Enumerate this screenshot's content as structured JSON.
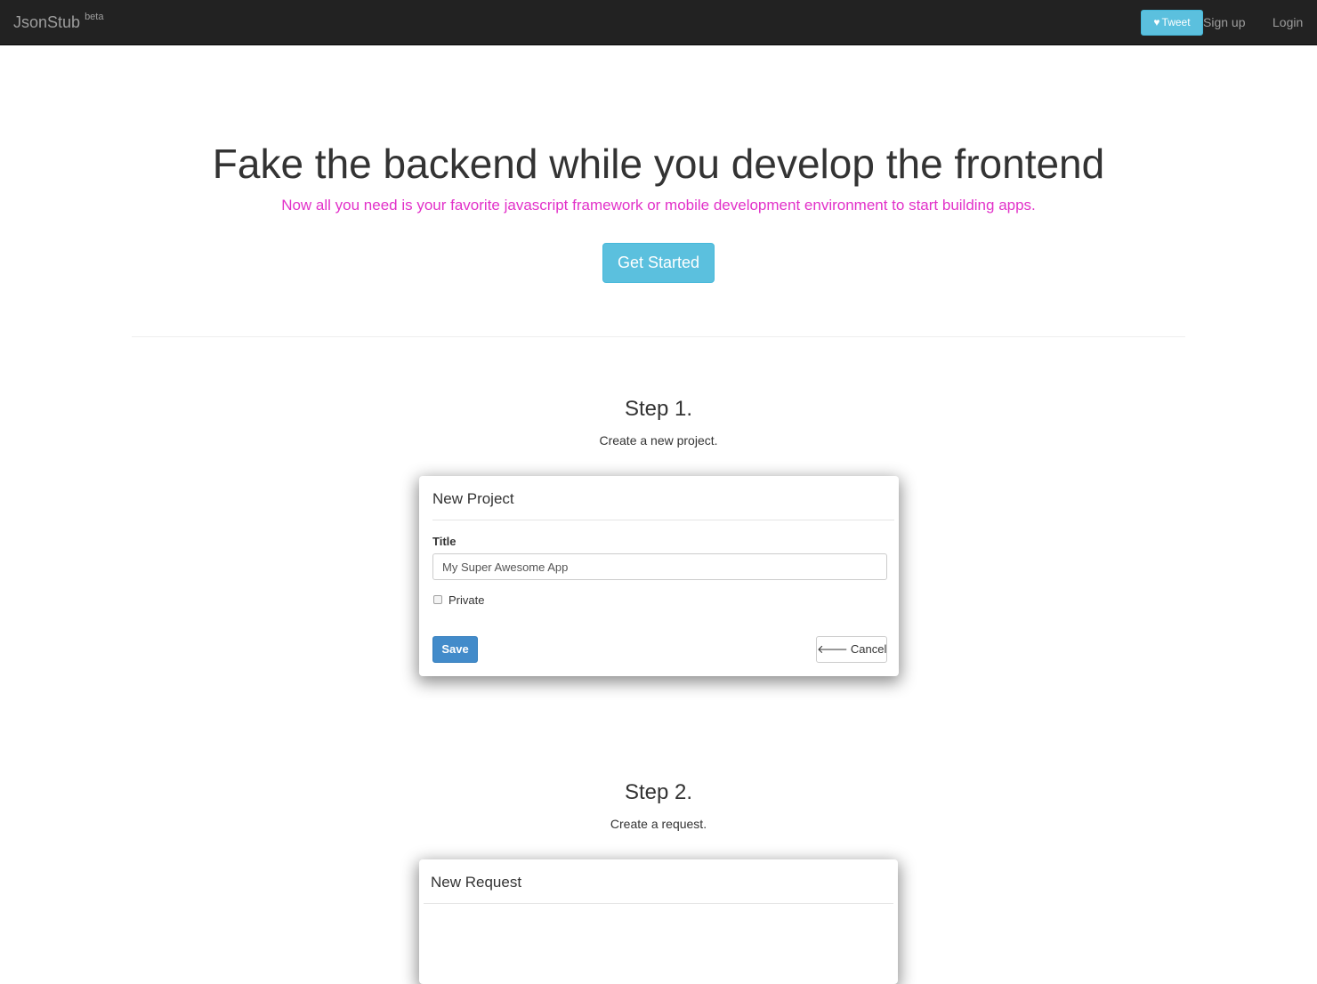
{
  "navbar": {
    "brand": "JsonStub",
    "brand_badge": "beta",
    "tweet_icon": "heart-icon",
    "tweet_label": "Tweet",
    "signup_label": "Sign up",
    "login_label": "Login"
  },
  "hero": {
    "title": "Fake the backend while you develop the frontend",
    "subtitle": "Now all you need is your favorite javascript framework or mobile development environment to start building apps.",
    "subtitle_color": "#e231c9",
    "cta_label": "Get Started"
  },
  "steps": [
    {
      "title": "Step 1.",
      "description": "Create a new project.",
      "card": {
        "heading": "New Project",
        "title_label": "Title",
        "title_value": "My Super Awesome App",
        "private_label": "Private",
        "private_checked": false,
        "save_label": "Save",
        "cancel_icon": "arrow-left-icon",
        "cancel_label": "Cancel"
      }
    },
    {
      "title": "Step 2.",
      "description": "Create a request.",
      "card": {
        "heading": "New Request"
      }
    }
  ],
  "colors": {
    "navbar_bg": "#222222",
    "info_button": "#5bc0de",
    "primary_button": "#428bca"
  }
}
